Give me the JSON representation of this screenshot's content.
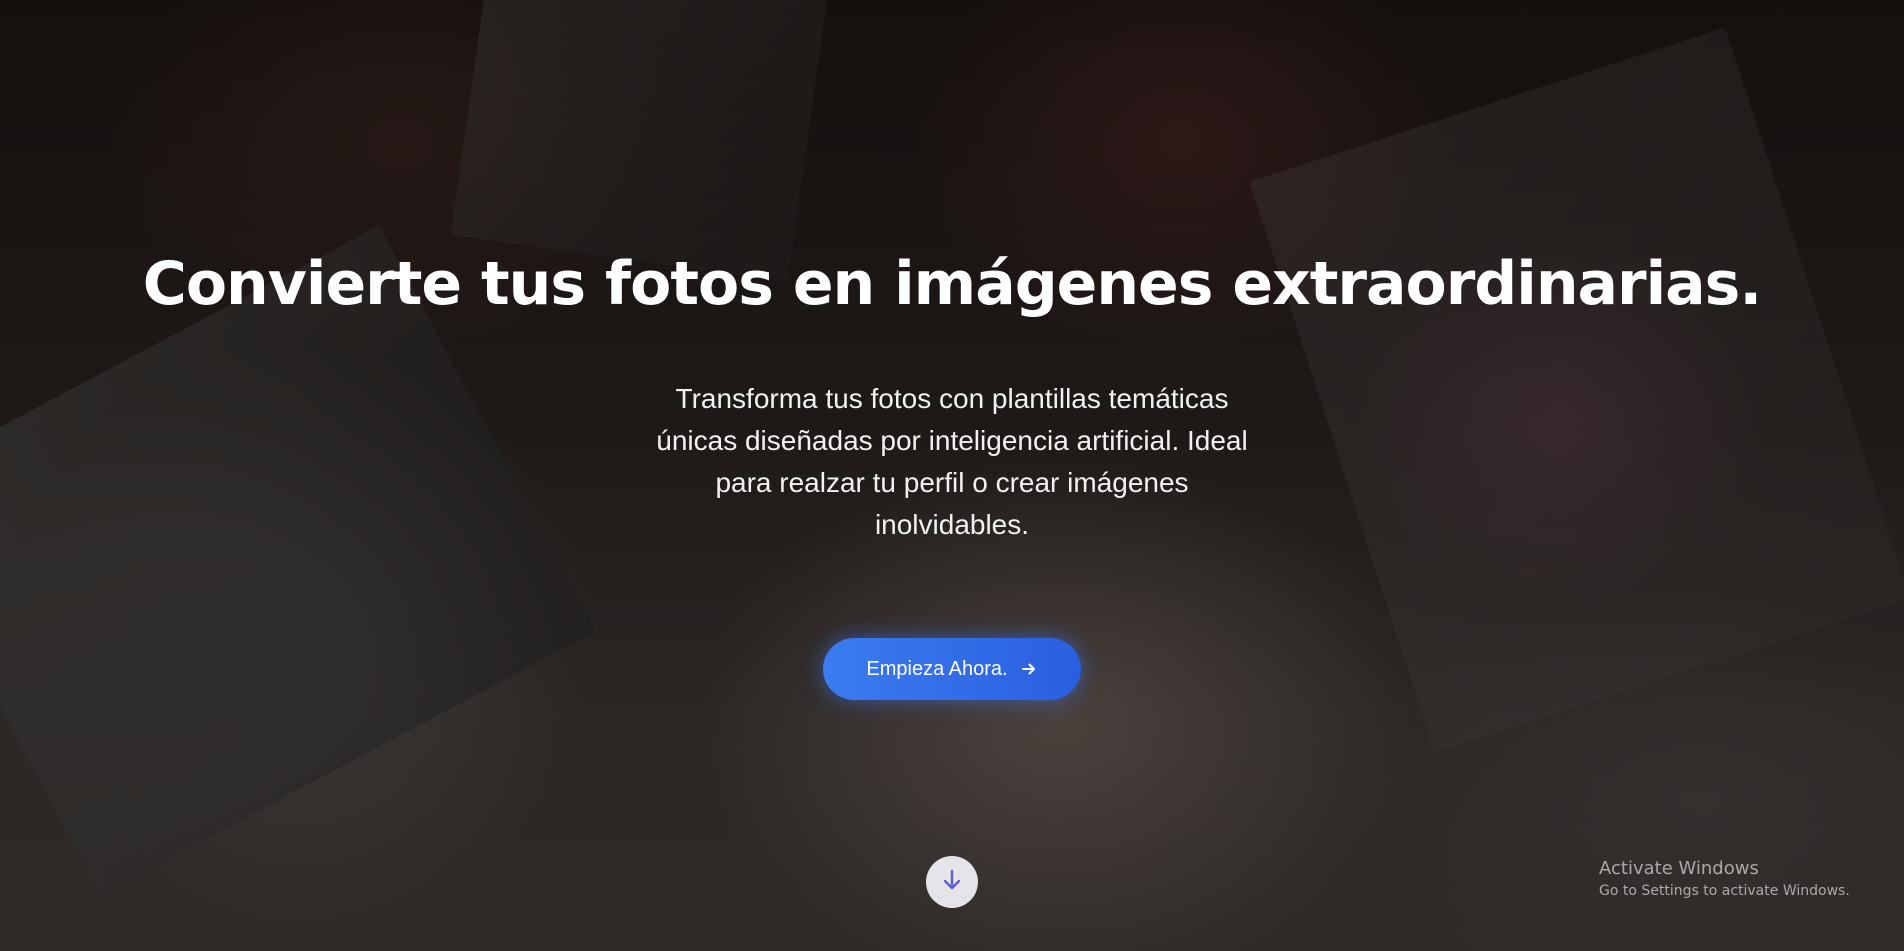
{
  "hero": {
    "headline": "Convierte tus fotos en imágenes extraordinarias.",
    "subtitle": "Transforma tus fotos con plantillas temáticas únicas diseñadas por inteligencia artificial. Ideal para realzar tu perfil o crear imágenes inolvidables.",
    "cta_label": "Empieza Ahora.",
    "cta_icon": "arrow-right-icon",
    "scroll_icon": "arrow-down-icon"
  },
  "colors": {
    "cta_start": "#3b7cf0",
    "cta_end": "#2a5fe0",
    "scroll_arrow": "#5b5fd8"
  },
  "os_watermark": {
    "title": "Activate Windows",
    "subtitle": "Go to Settings to activate Windows."
  }
}
